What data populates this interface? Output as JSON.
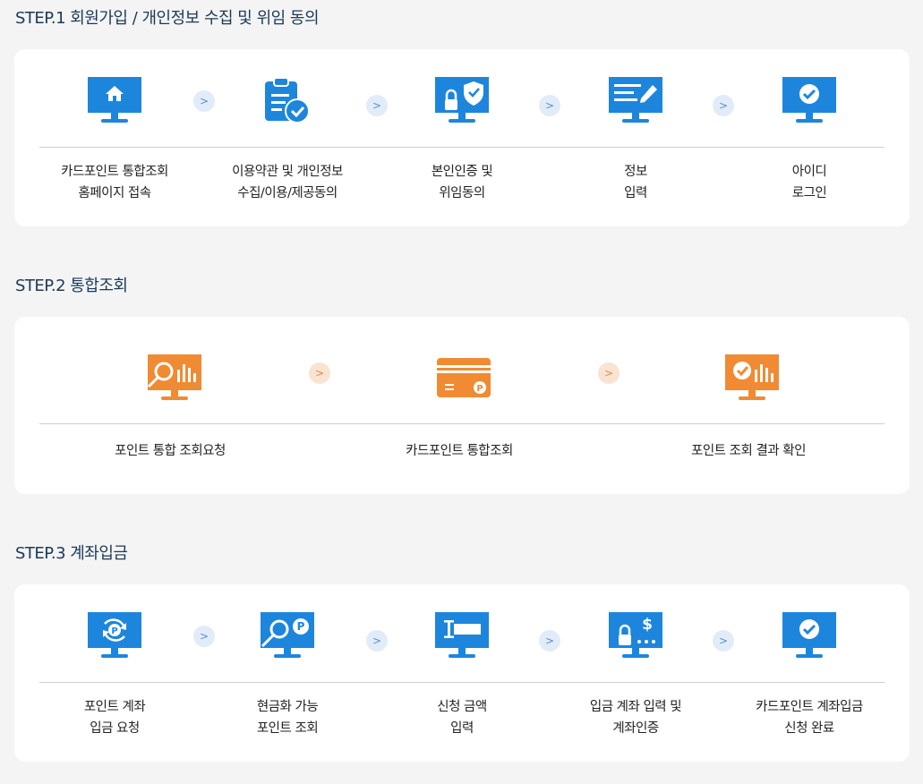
{
  "colors": {
    "blue": "#1d86dc",
    "orange": "#f08b33",
    "navy": "#1b3a57"
  },
  "step1": {
    "title": "STEP.1 회원가입 / 개인정보 수집 및 위임 동의",
    "items": [
      {
        "icon": "home-monitor-icon",
        "line1": "카드포인트 통합조회",
        "line2": "홈페이지 접속"
      },
      {
        "icon": "clipboard-check-icon",
        "line1": "이용약관 및 개인정보",
        "line2": "수집/이용/제공동의"
      },
      {
        "icon": "lock-shield-monitor-icon",
        "line1": "본인인증 및",
        "line2": "위임동의"
      },
      {
        "icon": "edit-form-monitor-icon",
        "line1": "정보",
        "line2": "입력"
      },
      {
        "icon": "check-monitor-icon",
        "line1": "아이디",
        "line2": "로그인"
      }
    ]
  },
  "step2": {
    "title": "STEP.2 통합조회",
    "items": [
      {
        "icon": "search-chart-monitor-icon",
        "line1": "포인트 통합 조회요청"
      },
      {
        "icon": "point-card-icon",
        "line1": "카드포인트 통합조회"
      },
      {
        "icon": "check-chart-monitor-icon",
        "line1": "포인트 조회 결과 확인"
      }
    ]
  },
  "step3": {
    "title": "STEP.3 계좌입금",
    "items": [
      {
        "icon": "point-refresh-monitor-icon",
        "line1": "포인트 계좌",
        "line2": "입금 요청"
      },
      {
        "icon": "search-point-monitor-icon",
        "line1": "현금화 가능",
        "line2": "포인트 조회"
      },
      {
        "icon": "input-monitor-icon",
        "line1": "신청 금액",
        "line2": "입력"
      },
      {
        "icon": "lock-dollar-monitor-icon",
        "line1": "입금 계좌 입력 및",
        "line2": "계좌인증"
      },
      {
        "icon": "check-monitor-icon",
        "line1": "카드포인트 계좌입금",
        "line2": "신청 완료"
      }
    ]
  },
  "arrow_glyph": ">"
}
